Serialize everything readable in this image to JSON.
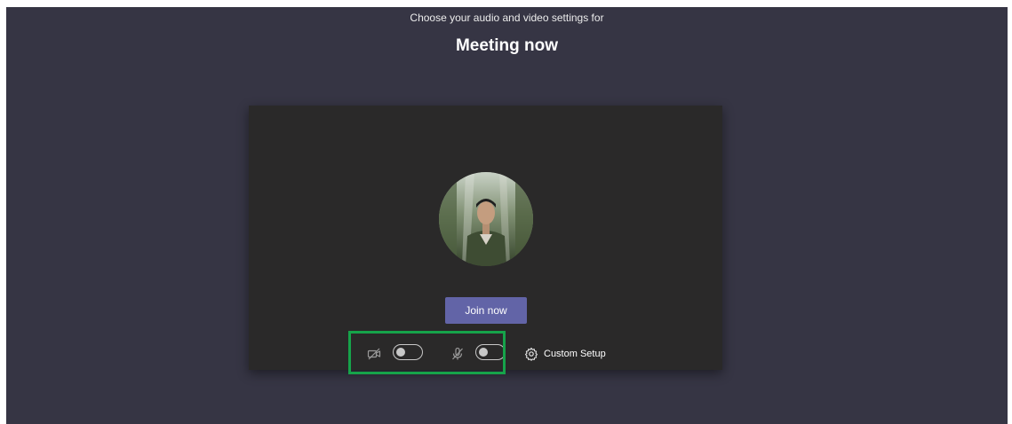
{
  "prejoin": {
    "subtitle": "Choose your audio and video settings for",
    "meeting_title": "Meeting now",
    "join_label": "Join now",
    "camera_on": false,
    "mic_on": false,
    "custom_setup_label": "Custom Setup"
  },
  "icons": {
    "camera": "camera-off-icon",
    "mic": "mic-off-icon",
    "settings": "gear-icon",
    "avatar": "user-avatar-photo"
  },
  "colors": {
    "background": "#363544",
    "preview_panel": "#2a2929",
    "join_button": "#6264a7",
    "highlight": "#16a34a"
  }
}
